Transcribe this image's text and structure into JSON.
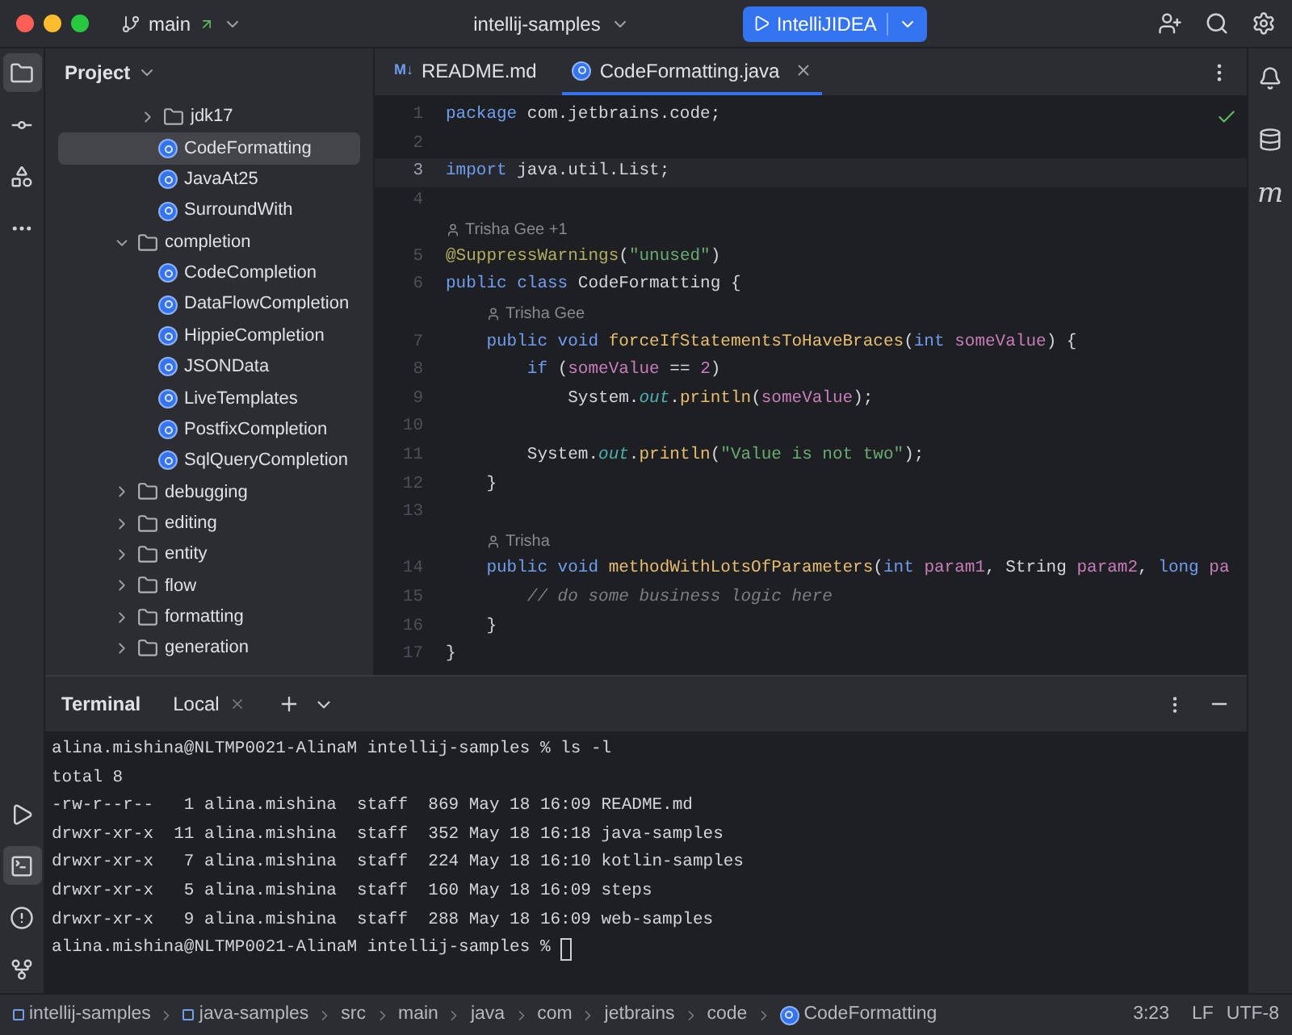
{
  "title_bar": {
    "branch": "main",
    "project": "intellij-samples",
    "run_config": "IntelliJIDEA"
  },
  "left_tools": [
    {
      "kind": "folder",
      "selected": true
    },
    {
      "kind": "commit",
      "selected": false
    },
    {
      "kind": "structure",
      "selected": false
    },
    {
      "kind": "more",
      "selected": false
    }
  ],
  "left_tools_bottom": [
    {
      "kind": "run",
      "selected": false
    },
    {
      "kind": "terminal",
      "selected": true
    },
    {
      "kind": "problems",
      "selected": false
    },
    {
      "kind": "git",
      "selected": false
    }
  ],
  "project": {
    "title": "Project",
    "leading": [
      {
        "label": "jdk17",
        "kind": "folder",
        "expanded": false,
        "selected": false
      },
      {
        "label": "CodeFormatting",
        "kind": "class",
        "selected": true
      },
      {
        "label": "JavaAt25",
        "kind": "class",
        "selected": false
      },
      {
        "label": "SurroundWith",
        "kind": "class",
        "selected": false
      }
    ],
    "items": [
      {
        "label": "completion",
        "kind": "folder",
        "expanded": true,
        "selected": false,
        "children": [
          {
            "label": "CodeCompletion",
            "kind": "class",
            "selected": false
          },
          {
            "label": "DataFlowCompletion",
            "kind": "class",
            "selected": false
          },
          {
            "label": "HippieCompletion",
            "kind": "class",
            "selected": false
          },
          {
            "label": "JSONData",
            "kind": "class",
            "selected": false
          },
          {
            "label": "LiveTemplates",
            "kind": "class",
            "selected": false
          },
          {
            "label": "PostfixCompletion",
            "kind": "class",
            "selected": false
          },
          {
            "label": "SqlQueryCompletion",
            "kind": "class",
            "selected": false
          }
        ]
      },
      {
        "label": "debugging",
        "kind": "folder",
        "expanded": false,
        "selected": false
      },
      {
        "label": "editing",
        "kind": "folder",
        "expanded": false,
        "selected": false
      },
      {
        "label": "entity",
        "kind": "folder",
        "expanded": false,
        "selected": false
      },
      {
        "label": "flow",
        "kind": "folder",
        "expanded": false,
        "selected": false
      },
      {
        "label": "formatting",
        "kind": "folder",
        "expanded": false,
        "selected": false
      },
      {
        "label": "generation",
        "kind": "folder",
        "expanded": false,
        "selected": false
      }
    ]
  },
  "editor_tabs": [
    {
      "label": "README.md",
      "kind": "markdown",
      "badge": "M↓",
      "selected": false
    },
    {
      "label": "CodeFormatting.java",
      "kind": "class",
      "selected": true
    }
  ],
  "editor": {
    "lines": [
      {
        "kind": "code",
        "number": "1",
        "current": false,
        "tokens": [
          {
            "kind": "kw",
            "text": "package"
          },
          {
            "kind": "plain",
            "text": " com.jetbrains.code;"
          }
        ]
      },
      {
        "kind": "code",
        "number": "2",
        "current": false
      },
      {
        "kind": "code",
        "number": "3",
        "current": true,
        "tokens": [
          {
            "kind": "kw",
            "text": "import"
          },
          {
            "kind": "plain",
            "text": " java.util.List;"
          }
        ]
      },
      {
        "kind": "code",
        "number": "4",
        "current": false
      },
      {
        "kind": "author",
        "text": "Trisha Gee +1",
        "nested": false
      },
      {
        "kind": "code",
        "number": "5",
        "current": false,
        "tokens": [
          {
            "kind": "annot",
            "text": "@SuppressWarnings"
          },
          {
            "kind": "plain",
            "text": "("
          },
          {
            "kind": "str",
            "text": "\"unused\""
          },
          {
            "kind": "plain",
            "text": ")"
          }
        ]
      },
      {
        "kind": "code",
        "number": "6",
        "current": false,
        "tokens": [
          {
            "kind": "kw",
            "text": "public class"
          },
          {
            "kind": "plain",
            "text": " CodeFormatting {"
          }
        ]
      },
      {
        "kind": "author",
        "text": "Trisha Gee",
        "nested": true
      },
      {
        "kind": "code",
        "number": "7",
        "current": false,
        "tokens": [
          {
            "kind": "kw",
            "text": "    public void "
          },
          {
            "kind": "method",
            "text": "forceIfStatementsToHaveBraces"
          },
          {
            "kind": "plain",
            "text": "("
          },
          {
            "kind": "kw",
            "text": "int "
          },
          {
            "kind": "param",
            "text": "someValue"
          },
          {
            "kind": "plain",
            "text": ") {"
          }
        ]
      },
      {
        "kind": "code",
        "number": "8",
        "current": false,
        "tokens": [
          {
            "kind": "kw",
            "text": "        if"
          },
          {
            "kind": "plain",
            "text": " ("
          },
          {
            "kind": "param",
            "text": "someValue"
          },
          {
            "kind": "plain",
            "text": " == "
          },
          {
            "kind": "num",
            "text": "2"
          },
          {
            "kind": "plain",
            "text": ")"
          }
        ]
      },
      {
        "kind": "code",
        "number": "9",
        "current": false,
        "tokens": [
          {
            "kind": "plain",
            "text": "            System."
          },
          {
            "kind": "field",
            "text": "out"
          },
          {
            "kind": "plain",
            "text": "."
          },
          {
            "kind": "method",
            "text": "println"
          },
          {
            "kind": "plain",
            "text": "("
          },
          {
            "kind": "param",
            "text": "someValue"
          },
          {
            "kind": "plain",
            "text": ");"
          }
        ]
      },
      {
        "kind": "code",
        "number": "10",
        "current": false
      },
      {
        "kind": "code",
        "number": "11",
        "current": false,
        "tokens": [
          {
            "kind": "plain",
            "text": "        System."
          },
          {
            "kind": "field",
            "text": "out"
          },
          {
            "kind": "plain",
            "text": "."
          },
          {
            "kind": "method",
            "text": "println"
          },
          {
            "kind": "plain",
            "text": "("
          },
          {
            "kind": "str",
            "text": "\"Value is not two\""
          },
          {
            "kind": "plain",
            "text": ");"
          }
        ]
      },
      {
        "kind": "code",
        "number": "12",
        "current": false,
        "tokens": [
          {
            "kind": "plain",
            "text": "    }"
          }
        ]
      },
      {
        "kind": "code",
        "number": "13",
        "current": false
      },
      {
        "kind": "author",
        "text": "Trisha",
        "nested": true
      },
      {
        "kind": "code",
        "number": "14",
        "current": false,
        "tokens": [
          {
            "kind": "kw",
            "text": "    public void "
          },
          {
            "kind": "method",
            "text": "methodWithLotsOfParameters"
          },
          {
            "kind": "plain",
            "text": "("
          },
          {
            "kind": "kw",
            "text": "int "
          },
          {
            "kind": "param",
            "text": "param1"
          },
          {
            "kind": "plain",
            "text": ", String "
          },
          {
            "kind": "param",
            "text": "param2"
          },
          {
            "kind": "plain",
            "text": ", "
          },
          {
            "kind": "kw",
            "text": "long "
          },
          {
            "kind": "param",
            "text": "pa"
          }
        ]
      },
      {
        "kind": "code",
        "number": "15",
        "current": false,
        "tokens": [
          {
            "kind": "comment",
            "text": "        // do some business logic here"
          }
        ]
      },
      {
        "kind": "code",
        "number": "16",
        "current": false,
        "tokens": [
          {
            "kind": "plain",
            "text": "    }"
          }
        ]
      },
      {
        "kind": "code",
        "number": "17",
        "current": false,
        "tokens": [
          {
            "kind": "plain",
            "text": "}"
          }
        ]
      }
    ]
  },
  "right_tools": [
    {
      "kind": "bell"
    },
    {
      "kind": "database"
    },
    {
      "kind": "letter",
      "text": "m"
    }
  ],
  "terminal": {
    "title": "Terminal",
    "tabs": [
      {
        "label": "Local",
        "selected": true
      }
    ],
    "lines": [
      "alina.mishina@NLTMP0021-AlinaM intellij-samples % ls -l",
      "total 8",
      "-rw-r--r--   1 alina.mishina  staff  869 May 18 16:09 README.md",
      "drwxr-xr-x  11 alina.mishina  staff  352 May 18 16:18 java-samples",
      "drwxr-xr-x   7 alina.mishina  staff  224 May 18 16:10 kotlin-samples",
      "drwxr-xr-x   5 alina.mishina  staff  160 May 18 16:09 steps",
      "drwxr-xr-x   9 alina.mishina  staff  288 May 18 16:09 web-samples"
    ],
    "prompt": "alina.mishina@NLTMP0021-AlinaM intellij-samples %"
  },
  "status_bar": {
    "breadcrumbs": [
      {
        "label": "intellij-samples",
        "kind": "module"
      },
      {
        "label": "java-samples",
        "kind": "module"
      },
      {
        "label": "src",
        "kind": "plain"
      },
      {
        "label": "main",
        "kind": "plain"
      },
      {
        "label": "java",
        "kind": "plain"
      },
      {
        "label": "com",
        "kind": "plain"
      },
      {
        "label": "jetbrains",
        "kind": "plain"
      },
      {
        "label": "code",
        "kind": "plain"
      },
      {
        "label": "CodeFormatting",
        "kind": "class"
      }
    ],
    "position": "3:23",
    "line_separator": "LF",
    "encoding": "UTF-8"
  }
}
